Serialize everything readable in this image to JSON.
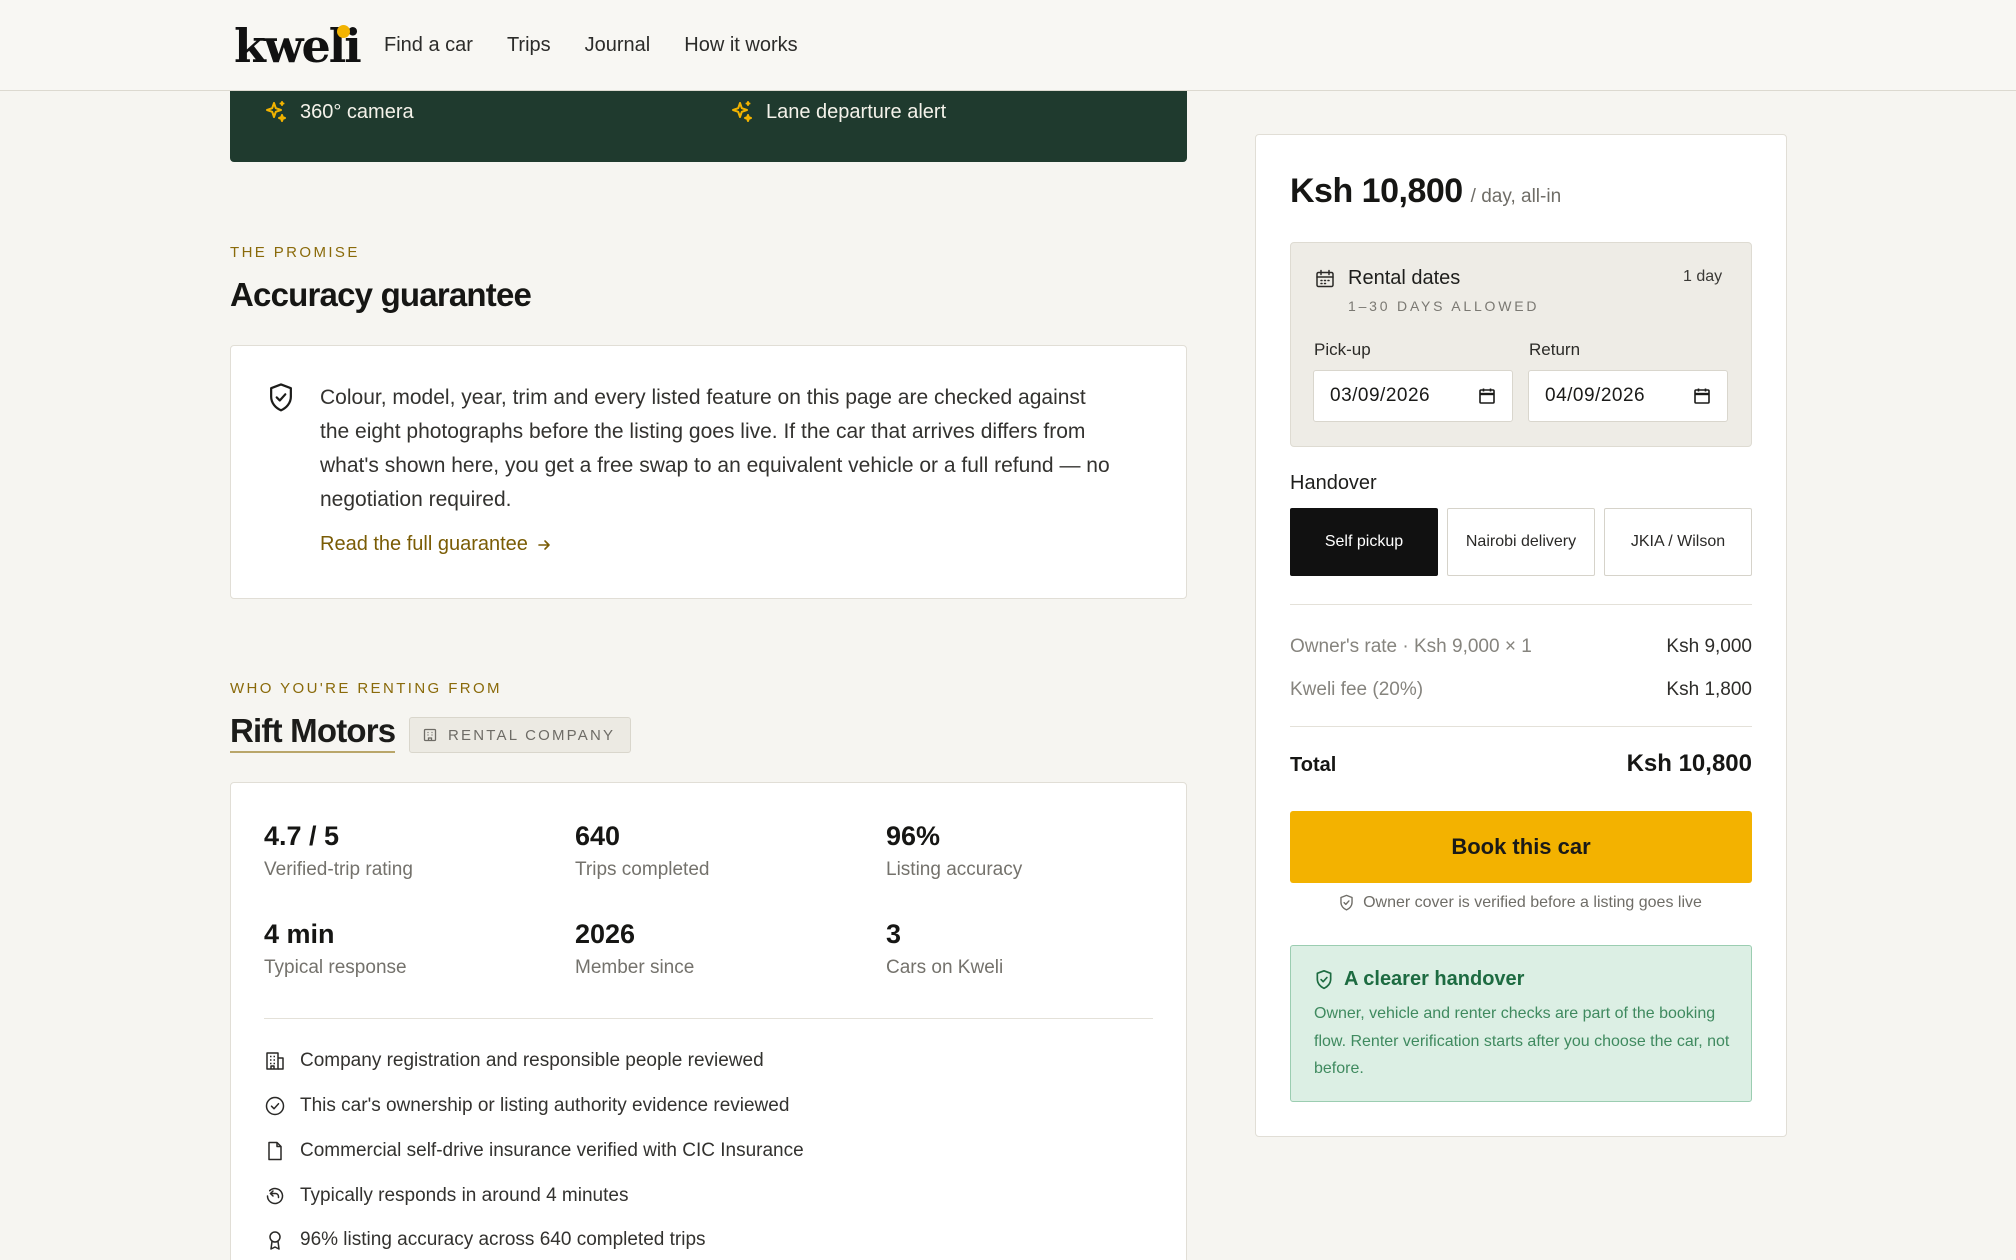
{
  "header": {
    "logo": "kweli",
    "nav": [
      "Find a car",
      "Trips",
      "Journal",
      "How it works"
    ]
  },
  "features": {
    "items": [
      "360° camera",
      "Lane departure alert"
    ]
  },
  "promise": {
    "eyebrow": "THE PROMISE",
    "title": "Accuracy guarantee",
    "text": "Colour, model, year, trim and every listed feature on this page are checked against the eight photographs before the listing goes live. If the car that arrives differs from what's shown here, you get a free swap to an equivalent vehicle or a full refund — no negotiation required.",
    "link": "Read the full guarantee"
  },
  "owner": {
    "eyebrow": "WHO YOU'RE RENTING FROM",
    "name": "Rift Motors",
    "badge": "RENTAL COMPANY",
    "stats": [
      {
        "value": "4.7 / 5",
        "label": "Verified-trip rating"
      },
      {
        "value": "640",
        "label": "Trips completed"
      },
      {
        "value": "96%",
        "label": "Listing accuracy"
      },
      {
        "value": "4 min",
        "label": "Typical response"
      },
      {
        "value": "2026",
        "label": "Member since"
      },
      {
        "value": "3",
        "label": "Cars on Kweli"
      }
    ],
    "checks": [
      {
        "icon": "building-icon",
        "text": "Company registration and responsible people reviewed"
      },
      {
        "icon": "check-circle-icon",
        "text": "This car's ownership or listing authority evidence reviewed"
      },
      {
        "icon": "document-icon",
        "text": "Commercial self-drive insurance verified with CIC Insurance"
      },
      {
        "icon": "reply-icon",
        "text": "Typically responds in around 4 minutes"
      },
      {
        "icon": "award-icon",
        "text": "96% listing accuracy across 640 completed trips"
      }
    ]
  },
  "booking": {
    "price": "Ksh 10,800",
    "price_unit": "/ day, all-in",
    "dates": {
      "title": "Rental dates",
      "count": "1 day",
      "subtitle": "1–30 DAYS ALLOWED",
      "pickup_label": "Pick-up",
      "pickup_value": "03/09/2026",
      "return_label": "Return",
      "return_value": "04/09/2026"
    },
    "handover": {
      "title": "Handover",
      "options": [
        "Self pickup",
        "Nairobi delivery",
        "JKIA / Wilson"
      ],
      "selected": "Self pickup"
    },
    "lines": [
      {
        "label": "Owner's rate · Ksh 9,000 × 1",
        "value": "Ksh 9,000"
      },
      {
        "label": "Kweli fee (20%)",
        "value": "Ksh 1,800"
      }
    ],
    "total_label": "Total",
    "total_value": "Ksh 10,800",
    "cta": "Book this car",
    "cover_note": "Owner cover is verified before a listing goes live",
    "clear_handover": {
      "title": "A clearer handover",
      "text": "Owner, vehicle and renter checks are part of the booking flow. Renter verification starts after you choose the car, not before."
    }
  },
  "colors": {
    "accent": "#f3b200",
    "banner": "#1f3a2e",
    "eyebrow": "#8a6a0a",
    "success_bg": "#dcefe4",
    "success_text": "#1d6b41"
  }
}
